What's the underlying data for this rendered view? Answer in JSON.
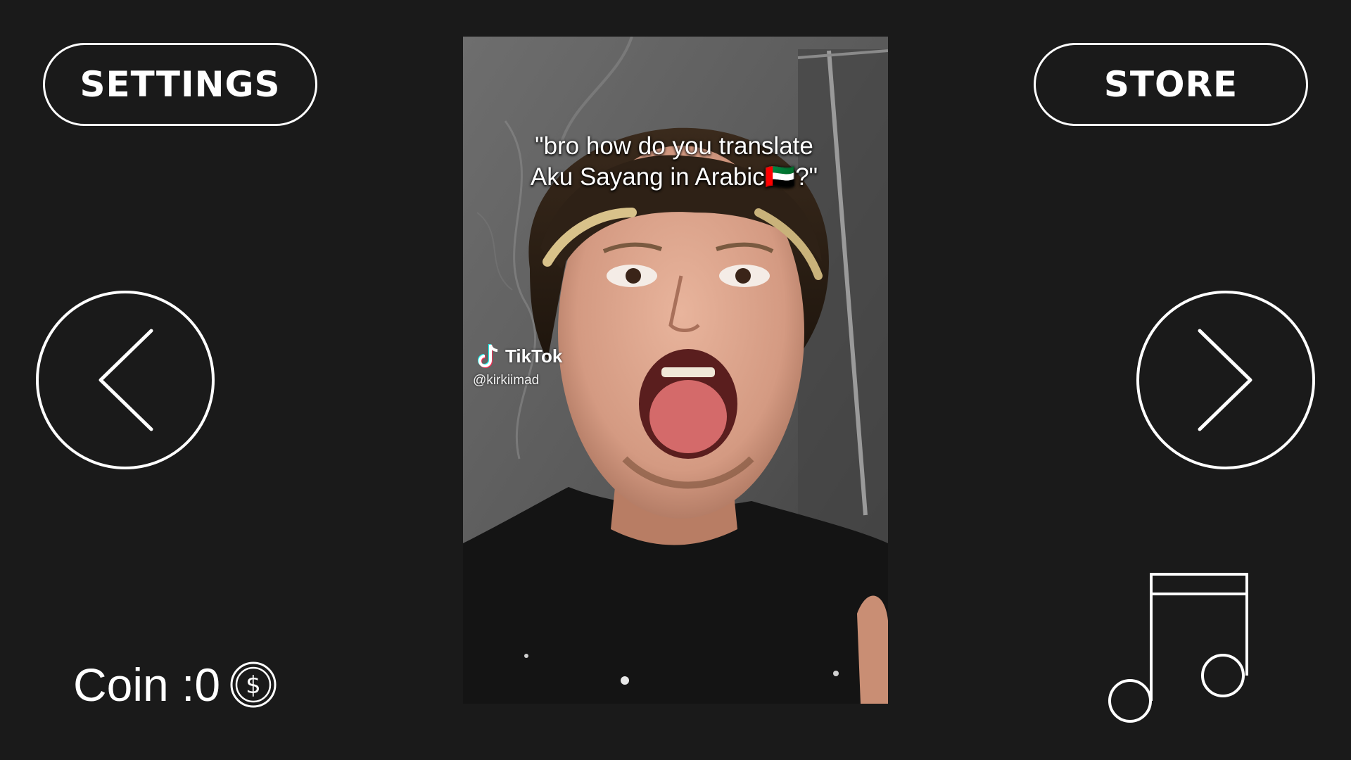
{
  "header": {
    "settings_label": "SETTINGS",
    "store_label": "STORE"
  },
  "video": {
    "caption": "\"bro how do you translate\nAku Sayang in Arabic🇦🇪?\"",
    "watermark_brand": "TikTok",
    "watermark_handle": "@kirkiimad"
  },
  "navigation": {
    "prev_icon": "chevron-left-icon",
    "next_icon": "chevron-right-icon"
  },
  "coins": {
    "label": "Coin :0",
    "icon": "dollar-coin-icon"
  },
  "music": {
    "icon": "music-note-icon"
  },
  "colors": {
    "background": "#1a1a1a",
    "foreground": "#ffffff"
  }
}
